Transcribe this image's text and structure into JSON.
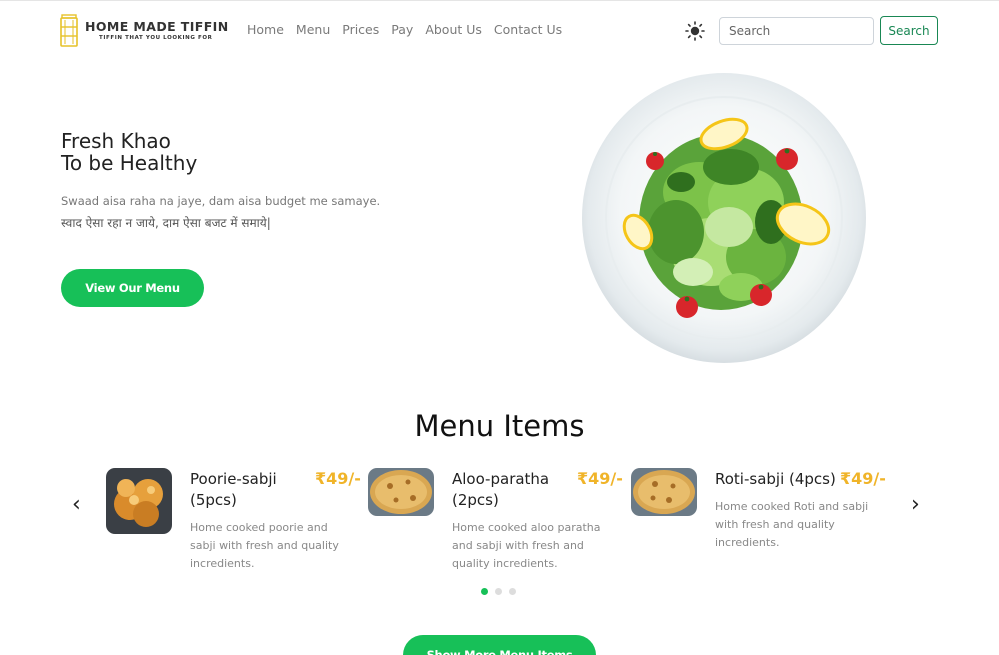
{
  "brand": {
    "name": "HOME MADE TIFFIN",
    "tagline": "TIFFIN THAT YOU LOOKING FOR"
  },
  "nav": {
    "links": [
      "Home",
      "Menu",
      "Prices",
      "Pay",
      "About Us",
      "Contact Us"
    ]
  },
  "search": {
    "placeholder": "Search",
    "button_label": "Search"
  },
  "hero": {
    "title_line1": "Fresh Khao",
    "title_line2": "To be Healthy",
    "tagline_en": "Swaad aisa raha na jaye, dam aisa budget me samaye.",
    "tagline_hi": "स्वाद ऐसा रहा न जाये, दाम ऐसा बजट में समाये|",
    "cta_label": "View Our Menu"
  },
  "menu": {
    "heading": "Menu Items",
    "prev_label": "‹",
    "next_label": "›",
    "items": [
      {
        "name": "Poorie-sabji (5pcs)",
        "price": "₹49/-",
        "description": "Home cooked poorie and sabji with fresh and quality incredients."
      },
      {
        "name": "Aloo-paratha (2pcs)",
        "price": "₹49/-",
        "description": "Home cooked aloo paratha and sabji with fresh and quality incredients."
      },
      {
        "name": "Roti-sabji (4pcs)",
        "price": "₹49/-",
        "description": "Home cooked Roti and sabji with fresh and quality incredients."
      }
    ],
    "active_slide": 1,
    "slide_count": 3,
    "more_label": "Show More Menu Items"
  },
  "colors": {
    "accent_green": "#17c058",
    "search_green": "#198754",
    "price_yellow": "#f0b429"
  },
  "icons": {
    "theme_toggle": "sun-icon",
    "logo": "tiffin-box-icon"
  }
}
